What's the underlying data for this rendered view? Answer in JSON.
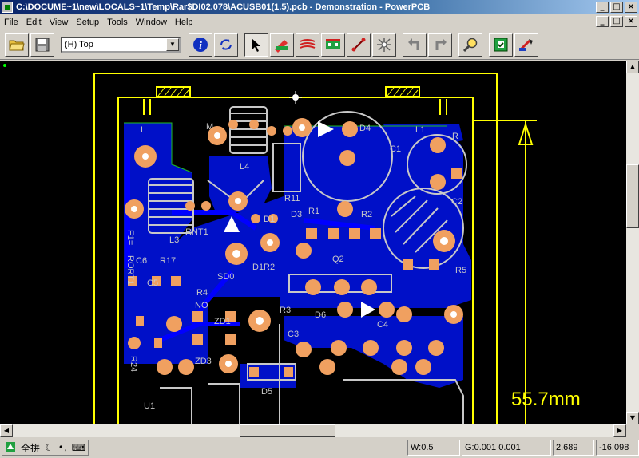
{
  "window": {
    "title": "C:\\DOCUME~1\\new\\LOCALS~1\\Temp\\Rar$DI02.078\\ACUSB01(1.5).pcb - Demonstration - PowerPCB",
    "minimize": "_",
    "maximize": "□",
    "close": "×"
  },
  "menu": {
    "items": [
      "File",
      "Edit",
      "View",
      "Setup",
      "Tools",
      "Window",
      "Help"
    ]
  },
  "toolbar": {
    "layer_value": "(H) Top",
    "icons": [
      "open-icon",
      "save-icon",
      "info-icon",
      "redraw-icon",
      "select-icon",
      "drafting-icon",
      "design-icon",
      "ecogate-icon",
      "route-icon",
      "cluster-icon",
      "undo-icon",
      "redo-icon",
      "zoom-icon",
      "verify-icon",
      "cam-icon"
    ]
  },
  "canvas": {
    "dimension_label": "55.7mm",
    "labels": {
      "L": "L",
      "M": "M",
      "D4": "D4",
      "L1": "L1",
      "C1": "C1",
      "R": "R",
      "L4": "L4",
      "C2": "C2",
      "RNT1": "RNT1",
      "L3": "L3",
      "F1": "F1=",
      "D3": "D3",
      "R1": "R1",
      "R2": "R2",
      "D1": "D1",
      "Q2": "Q2",
      "R5": "R5",
      "C6": "C6",
      "R17": "R17",
      "D1R2": "D1R2",
      "SD0": "SD0",
      "D6": "D6",
      "C4": "C4",
      "R3": "R3",
      "C3": "C3",
      "R24": "R24",
      "D5": "D5",
      "U1": "U1",
      "R4": "R4",
      "NO": "NO",
      "ZD3": "ZD3",
      "ZD1": "ZD1",
      "C5": "C5",
      "R11": "R11",
      "RORT1": "RORT1"
    }
  },
  "ime": {
    "items": [
      "全拼",
      "☾",
      "•,",
      "⌨"
    ]
  },
  "status": {
    "width": "W:0.5",
    "grid": "G:0.001 0.001",
    "x": "2.689",
    "y": "-16.098"
  },
  "colors": {
    "board": "#0000c8",
    "pad": "#f0a060",
    "silk": "#c8c8c8",
    "outline": "#ffff00",
    "trace": "#0000ff",
    "canvas_bg": "#000000"
  }
}
